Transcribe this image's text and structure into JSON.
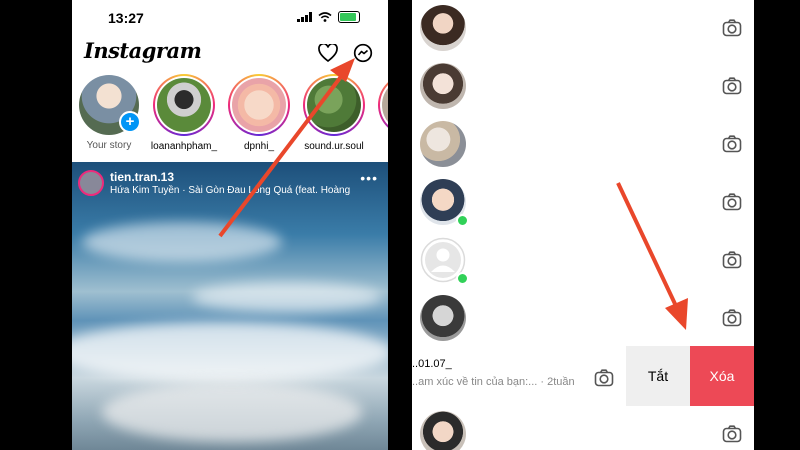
{
  "colors": {
    "instagram_blue": "#0095f6",
    "delete_red": "#ed4956",
    "online_green": "#31d158",
    "annotation_arrow": "#e9472b"
  },
  "left": {
    "status": {
      "time": "13:27"
    },
    "header": {
      "logo": "Instagram",
      "activity_icon": "heart-icon",
      "messenger_icon": "messenger-icon"
    },
    "stories": [
      {
        "label": "Your story"
      },
      {
        "label": "loananhpham_"
      },
      {
        "label": "dpnhi_"
      },
      {
        "label": "sound.ur.soul"
      }
    ],
    "post": {
      "username": "tien.tran.13",
      "song": "Hứa Kim Tuyền · Sài Gòn Đau Lòng Quá (feat. Hoàng D...",
      "more": "•••"
    }
  },
  "right": {
    "swipe": {
      "name": "..01.07_",
      "message": "..am xúc về tin của bạn:... · 2tuần",
      "mute_label": "Tắt",
      "delete_label": "Xóa"
    }
  }
}
